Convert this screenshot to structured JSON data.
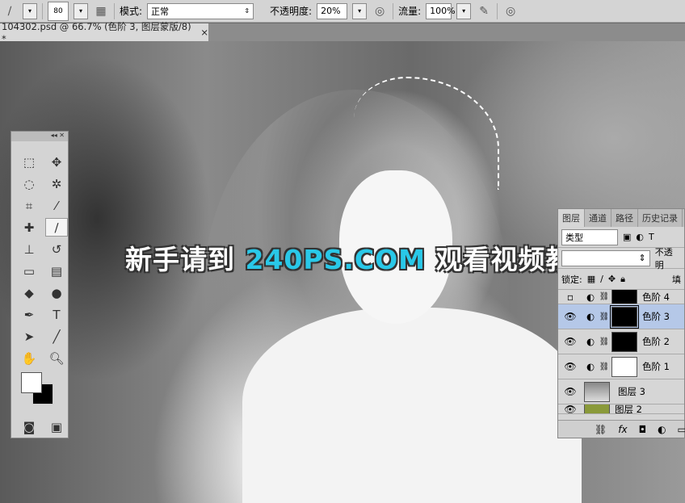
{
  "options_bar": {
    "brush_size": "80",
    "mode_label": "模式:",
    "mode_value": "正常",
    "opacity_label": "不透明度:",
    "opacity_value": "20%",
    "flow_label": "流量:",
    "flow_value": "100%"
  },
  "document_tab": {
    "title": "104302.psd @ 66.7% (色阶 3, 图层蒙版/8) *",
    "close": "×"
  },
  "watermark": {
    "part1": "新手请到 ",
    "part2": "240PS.COM",
    "part3": " 观看视频教程"
  },
  "tools_panel": {
    "collapse": "◂◂ ✕"
  },
  "layers_panel": {
    "tabs": [
      "图层",
      "通道",
      "路径",
      "历史记录"
    ],
    "filter_kind": "类型",
    "opacity_label": "不透明",
    "lock_label": "锁定:",
    "fill_label": "填",
    "layers": [
      {
        "name": "色阶 4",
        "mask": "black"
      },
      {
        "name": "色阶 3",
        "mask": "black",
        "selected": true
      },
      {
        "name": "色阶 2",
        "mask": "black"
      },
      {
        "name": "色阶 1",
        "mask": "white"
      },
      {
        "name": "图层 3"
      },
      {
        "name": "图层 2"
      }
    ]
  }
}
